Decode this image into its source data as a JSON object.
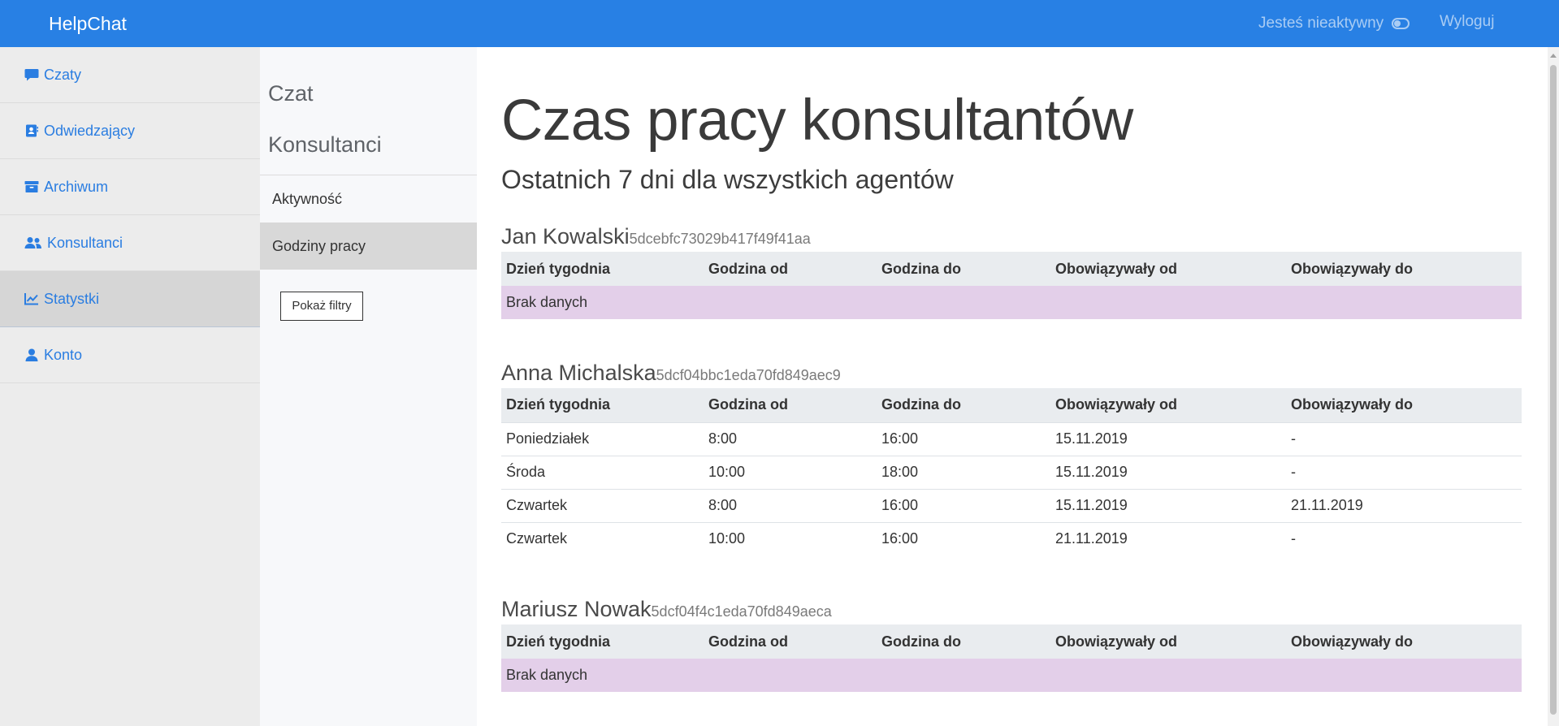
{
  "topbar": {
    "brand": "HelpChat",
    "status_text": "Jesteś nieaktywny",
    "logout": "Wyloguj"
  },
  "sidebar": {
    "items": [
      {
        "label": "Czaty",
        "icon": "chat-icon"
      },
      {
        "label": "Odwiedzający",
        "icon": "contact-card-icon"
      },
      {
        "label": "Archiwum",
        "icon": "archive-box-icon"
      },
      {
        "label": "Konsultanci",
        "icon": "users-icon"
      },
      {
        "label": "Statystki",
        "icon": "chart-line-icon",
        "active": true
      },
      {
        "label": "Konto",
        "icon": "user-icon"
      }
    ]
  },
  "subnav": {
    "heading1": "Czat",
    "heading2": "Konsultanci",
    "items": [
      {
        "label": "Aktywność"
      },
      {
        "label": "Godziny pracy",
        "active": true
      }
    ],
    "filter_button": "Pokaż filtry"
  },
  "main": {
    "title": "Czas pracy konsultantów",
    "subtitle": "Ostatnich 7 dni dla wszystkich agentów",
    "columns": [
      "Dzień tygodnia",
      "Godzina od",
      "Godzina do",
      "Obowiązywały od",
      "Obowiązywały do"
    ],
    "agents": [
      {
        "name": "Jan Kowalski",
        "id": "5dcebfc73029b417f49f41aa",
        "empty_text": "Brak danych",
        "rows": []
      },
      {
        "name": "Anna Michalska",
        "id": "5dcf04bbc1eda70fd849aec9",
        "rows": [
          [
            "Poniedziałek",
            "8:00",
            "16:00",
            "15.11.2019",
            "-"
          ],
          [
            "Środa",
            "10:00",
            "18:00",
            "15.11.2019",
            "-"
          ],
          [
            "Czwartek",
            "8:00",
            "16:00",
            "15.11.2019",
            "21.11.2019"
          ],
          [
            "Czwartek",
            "10:00",
            "16:00",
            "21.11.2019",
            "-"
          ]
        ]
      },
      {
        "name": "Mariusz Nowak",
        "id": "5dcf04f4c1eda70fd849aeca",
        "empty_text": "Brak danych",
        "rows": []
      }
    ]
  },
  "colors": {
    "topbar": "#2880e4",
    "link": "#2a7de1",
    "empty_row": "#e3cfe9"
  }
}
